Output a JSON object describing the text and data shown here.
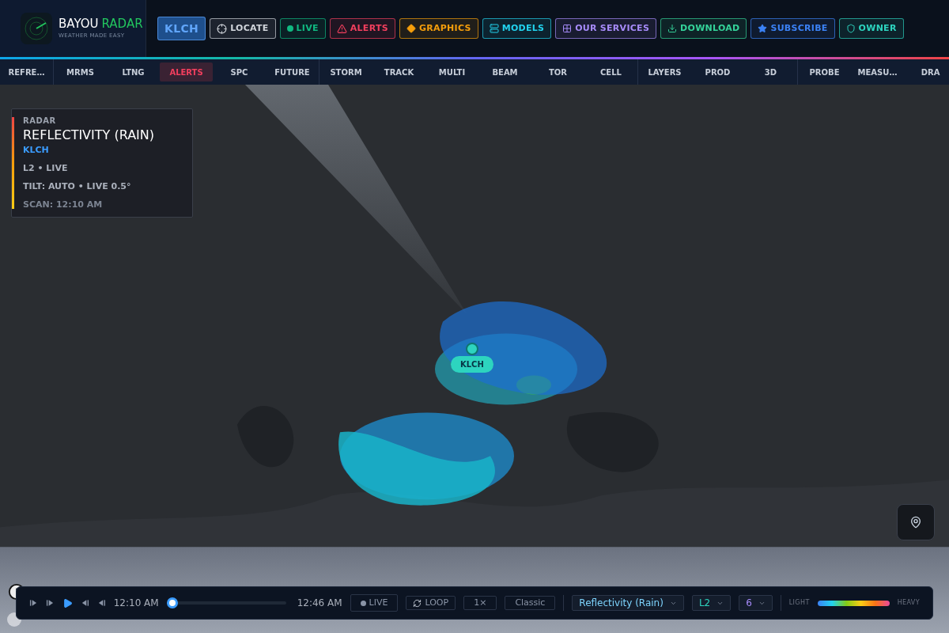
{
  "brand": {
    "name": "BAYOU",
    "accent": "RADAR",
    "tagline": "WEATHER MADE EASY"
  },
  "header_buttons": [
    {
      "label": "KLCH",
      "kind": "station"
    },
    {
      "label": "LOCATE",
      "kind": "locate"
    },
    {
      "label": "LIVE",
      "kind": "live"
    },
    {
      "label": "ALERTS",
      "kind": "alerts"
    },
    {
      "label": "GRAPHICS",
      "kind": "graphics"
    },
    {
      "label": "MODELS",
      "kind": "models"
    },
    {
      "label": "OUR SERVICES",
      "kind": "services"
    },
    {
      "label": "DOWNLOAD",
      "kind": "download"
    },
    {
      "label": "SUBSCRIBE",
      "kind": "subscribe"
    },
    {
      "label": "OWNER",
      "kind": "owner"
    }
  ],
  "tab_groups": [
    [
      {
        "label": "REFRE…",
        "selected": false
      }
    ],
    [
      {
        "label": "MRMS",
        "selected": false
      },
      {
        "label": "LTNG",
        "selected": false
      },
      {
        "label": "ALERTS",
        "selected": true
      },
      {
        "label": "SPC",
        "selected": false
      },
      {
        "label": "FUTURE",
        "selected": false
      }
    ],
    [
      {
        "label": "STORM",
        "selected": false
      },
      {
        "label": "TRACK",
        "selected": false
      },
      {
        "label": "MULTI",
        "selected": false
      },
      {
        "label": "BEAM",
        "selected": false
      },
      {
        "label": "TOR",
        "selected": false
      },
      {
        "label": "CELL",
        "selected": false
      }
    ],
    [
      {
        "label": "LAYERS",
        "selected": false
      },
      {
        "label": "PROD",
        "selected": false
      },
      {
        "label": "3D",
        "selected": false
      }
    ],
    [
      {
        "label": "PROBE",
        "selected": false
      },
      {
        "label": "MEASU…",
        "selected": false
      },
      {
        "label": "DRA",
        "selected": false
      }
    ]
  ],
  "info_panel": {
    "category": "RADAR",
    "product": "REFLECTIVITY (RAIN)",
    "station": "KLCH",
    "lines": [
      "L2 • LIVE",
      "TILT: AUTO • LIVE 0.5°",
      "SCAN: 12:10 AM"
    ]
  },
  "site_marker": {
    "label": "KLCH"
  },
  "player": {
    "start_time": "12:10 AM",
    "end_time": "12:46 AM",
    "level": 0,
    "playing": false,
    "live": "LIVE",
    "loop": "LOOP",
    "speed": "1×",
    "style": "Classic",
    "product": "Reflectivity (Rain)",
    "level_select": "L2",
    "count": "6",
    "legend_low": "LIGHT",
    "legend_high": "HEAVY"
  }
}
